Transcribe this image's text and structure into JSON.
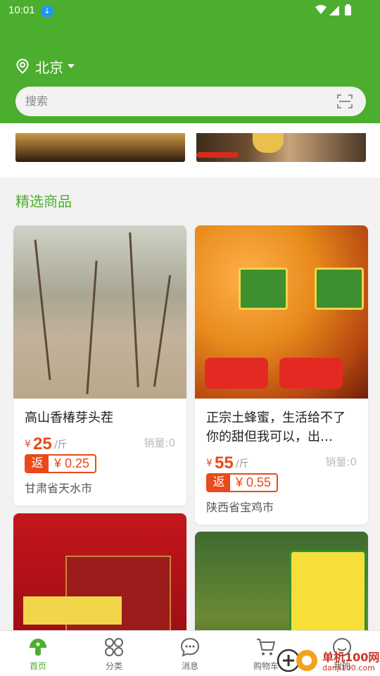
{
  "status_bar": {
    "time": "10:01"
  },
  "location": {
    "city": "北京"
  },
  "search": {
    "placeholder": "搜索"
  },
  "section": {
    "title": "精选商品"
  },
  "products": [
    {
      "name": "高山香椿芽头茬",
      "currency": "¥",
      "price": "25",
      "unit": "/斤",
      "sales": "销量:0",
      "rebate_tag": "返",
      "rebate": "¥ 0.25",
      "origin": "甘肃省天水市"
    },
    {
      "name": "正宗土蜂蜜，生活给不了你的甜但我可以，出…",
      "currency": "¥",
      "price": "55",
      "unit": "/斤",
      "sales": "销量:0",
      "rebate_tag": "返",
      "rebate": "¥ 0.55",
      "origin": "陕西省宝鸡市"
    }
  ],
  "tabbar": {
    "items": [
      {
        "label": "首页",
        "icon": "home-icon",
        "active": true
      },
      {
        "label": "分类",
        "icon": "category-icon"
      },
      {
        "label": "消息",
        "icon": "message-icon"
      },
      {
        "label": "购物车",
        "icon": "cart-icon"
      },
      {
        "label": "我的",
        "icon": "profile-icon"
      }
    ]
  },
  "watermark": {
    "line1": "单机100网",
    "line2": "danji100.com"
  },
  "colors": {
    "brand": "#4cae2e",
    "price": "#e84a1c"
  }
}
